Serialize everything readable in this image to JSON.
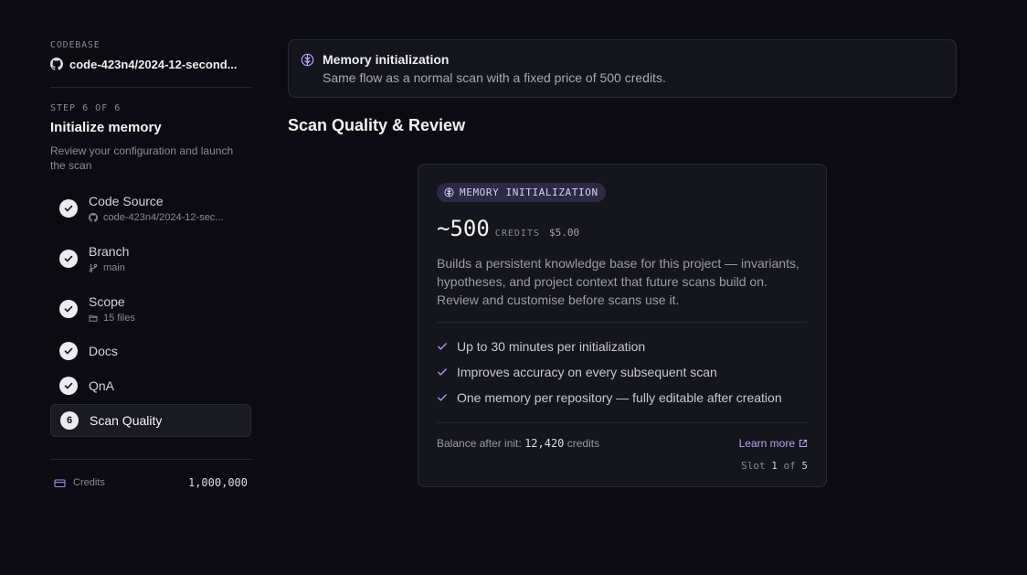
{
  "sidebar": {
    "codebase_label": "CODEBASE",
    "repo_name": "code-423n4/2024-12-second...",
    "step_label": "STEP 6 OF 6",
    "step_title": "Initialize memory",
    "step_desc": "Review your configuration and launch the scan",
    "steps": [
      {
        "name": "Code Source",
        "sub": "code-423n4/2024-12-sec...",
        "icon": "github-icon",
        "done": true
      },
      {
        "name": "Branch",
        "sub": "main",
        "icon": "branch-icon",
        "done": true
      },
      {
        "name": "Scope",
        "sub": "15 files",
        "icon": "folder-icon",
        "done": true
      },
      {
        "name": "Docs",
        "done": true
      },
      {
        "name": "QnA",
        "done": true
      },
      {
        "name": "Scan Quality",
        "number": "6",
        "active": true
      }
    ],
    "credits_label": "Credits",
    "credits_value": "1,000,000"
  },
  "banner": {
    "title": "Memory initialization",
    "text": "Same flow as a normal scan with a fixed price of 500 credits."
  },
  "section_title": "Scan Quality & Review",
  "card": {
    "badge": "MEMORY INITIALIZATION",
    "price": "~500",
    "price_unit": "CREDITS",
    "price_usd": "$5.00",
    "description": "Builds a persistent knowledge base for this project — invariants, hypotheses, and project context that future scans build on. Review and customise before scans use it.",
    "features": [
      "Up to 30 minutes per initialization",
      "Improves accuracy on every subsequent scan",
      "One memory per repository — fully editable after creation"
    ],
    "balance_label": "Balance after init:",
    "balance_value": "12,420",
    "balance_unit": "credits",
    "learn_more": "Learn more",
    "slot_label": "Slot",
    "slot_current": "1",
    "slot_of": "of",
    "slot_total": "5"
  },
  "colors": {
    "background": "#0b0b11",
    "accent": "#b7a4f6",
    "badge_bg": "#2d2a45"
  }
}
